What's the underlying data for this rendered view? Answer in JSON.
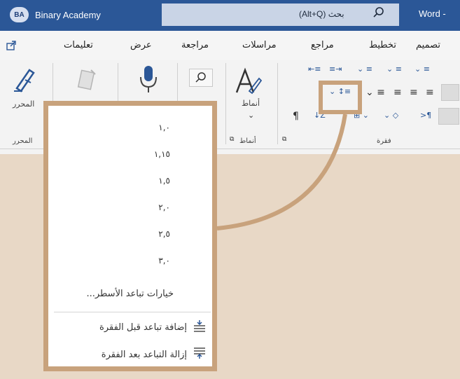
{
  "titlebar": {
    "avatar_initials": "BA",
    "account_name": "Binary Academy",
    "search_text": "بحث (Alt+Q)",
    "app_name": "Word -"
  },
  "tabs": [
    "تصميم",
    "تخطيط",
    "مراجع",
    "مراسلات",
    "مراجعة",
    "عرض",
    "تعليمات"
  ],
  "ribbon": {
    "editor_label": "المحرر",
    "editor_group": "المحرر",
    "styles_label": "أنماط",
    "styles_group": "أنماط",
    "paragraph_group": "فقرة",
    "pilcrow": "¶"
  },
  "line_spacing_menu": {
    "options": [
      "١,٠",
      "١,١٥",
      "١,٥",
      "٢,٠",
      "٢,٥",
      "٣,٠"
    ],
    "options_link": "خيارات تباعد الأسطر...",
    "add_space_before": "إضافة تباعد قبل الفقرة",
    "remove_space_after": "إزالة التباعد بعد الفقرة"
  },
  "colors": {
    "title_bar": "#2b5797",
    "callout": "#c8a27c",
    "background": "#e8d8c6"
  }
}
